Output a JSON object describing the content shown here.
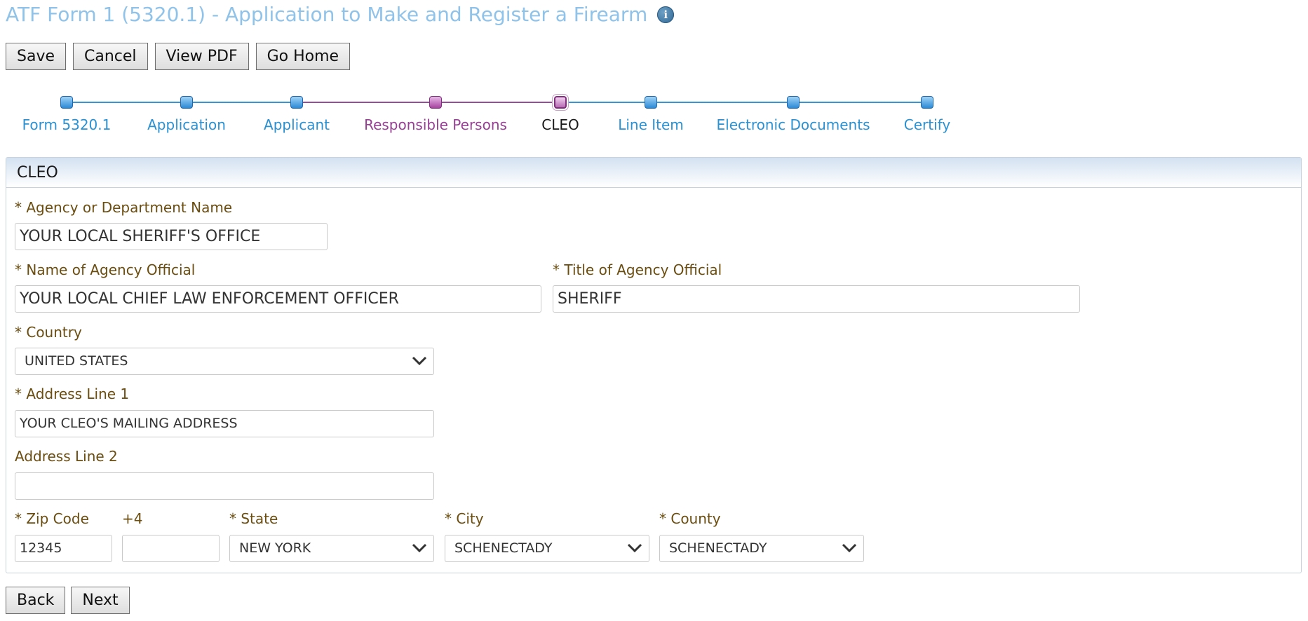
{
  "header": {
    "title": "ATF Form 1 (5320.1) - Application to Make and Register a Firearm",
    "info_icon": "info-icon"
  },
  "toolbar": {
    "save_label": "Save",
    "cancel_label": "Cancel",
    "view_pdf_label": "View PDF",
    "go_home_label": "Go Home"
  },
  "wizard": {
    "steps": [
      {
        "label": "Form 5320.1",
        "state": "visited"
      },
      {
        "label": "Application",
        "state": "visited"
      },
      {
        "label": "Applicant",
        "state": "visited"
      },
      {
        "label": "Responsible Persons",
        "state": "completed"
      },
      {
        "label": "CLEO",
        "state": "current"
      },
      {
        "label": "Line Item",
        "state": "visited"
      },
      {
        "label": "Electronic Documents",
        "state": "visited"
      },
      {
        "label": "Certify",
        "state": "visited"
      }
    ],
    "colors": {
      "blue": "#3596d3",
      "purple": "#9a4c9c"
    }
  },
  "panel": {
    "title": "CLEO",
    "agency": {
      "label": "* Agency or Department Name",
      "value": "YOUR LOCAL SHERIFF'S OFFICE"
    },
    "official_name": {
      "label": "* Name of Agency Official",
      "value": "YOUR LOCAL CHIEF LAW ENFORCEMENT OFFICER"
    },
    "official_title": {
      "label": "* Title of Agency Official",
      "value": "SHERIFF"
    },
    "country": {
      "label": "* Country",
      "value": "UNITED STATES"
    },
    "address1": {
      "label": "* Address Line 1",
      "value": "YOUR CLEO'S MAILING ADDRESS"
    },
    "address2": {
      "label": "Address Line 2",
      "value": ""
    },
    "zip": {
      "label": "* Zip Code",
      "value": "12345"
    },
    "plus4": {
      "label": "+4",
      "value": ""
    },
    "state": {
      "label": "* State",
      "value": "NEW YORK"
    },
    "city": {
      "label": "* City",
      "value": "SCHENECTADY"
    },
    "county": {
      "label": "* County",
      "value": "SCHENECTADY"
    }
  },
  "footer": {
    "back_label": "Back",
    "next_label": "Next"
  }
}
